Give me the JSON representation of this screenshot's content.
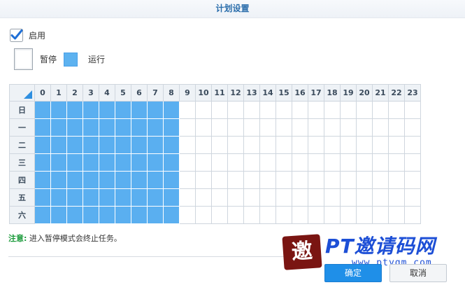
{
  "dialog": {
    "title": "计划设置"
  },
  "enable": {
    "label": "启用",
    "checked": true
  },
  "legend": {
    "pause_label": "暂停",
    "run_label": "运行"
  },
  "schedule": {
    "hours": [
      "0",
      "1",
      "2",
      "3",
      "4",
      "5",
      "6",
      "7",
      "8",
      "9",
      "10",
      "11",
      "12",
      "13",
      "14",
      "15",
      "16",
      "17",
      "18",
      "19",
      "20",
      "21",
      "22",
      "23"
    ],
    "days": [
      "日",
      "一",
      "二",
      "三",
      "四",
      "五",
      "六"
    ],
    "active_hours": [
      0,
      1,
      2,
      3,
      4,
      5,
      6,
      7,
      8
    ],
    "colors": {
      "active": "#5aaff0",
      "inactive": "#ffffff"
    }
  },
  "note": {
    "prefix": "注意:",
    "text": " 进入暂停模式会终止任务。"
  },
  "watermark": {
    "seal": "邀",
    "main": "PT邀请码网",
    "sub": "www.ptyqm.com"
  },
  "buttons": {
    "ok": "确定",
    "cancel": "取消"
  },
  "colors": {
    "accent": "#1f8fe8",
    "title": "#2a6dab",
    "note": "#1a9a3a"
  }
}
